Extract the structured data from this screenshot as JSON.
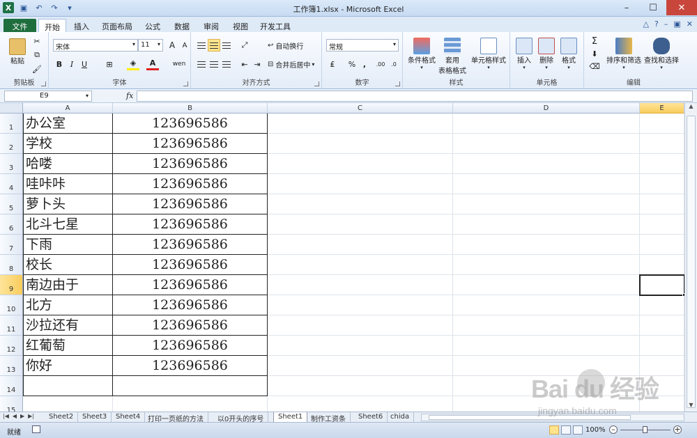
{
  "window": {
    "title": "工作簿1.xlsx - Microsoft Excel",
    "controls": {
      "minimize": "–",
      "maximize": "☐",
      "close": "✕"
    }
  },
  "qat": {
    "logo": "X",
    "save": "💾",
    "undo": "↶",
    "redo": "↷",
    "customize": "▾"
  },
  "tabs": [
    "文件",
    "开始",
    "插入",
    "页面布局",
    "公式",
    "数据",
    "审阅",
    "视图",
    "开发工具"
  ],
  "active_tab": "开始",
  "ribbon": {
    "clipboard": {
      "label": "剪贴板",
      "paste": "粘贴"
    },
    "font": {
      "label": "字体",
      "name": "宋体",
      "size": "11",
      "grow": "A",
      "shrink": "A",
      "bold": "B",
      "italic": "I",
      "underline": "U",
      "fontcolor": "A",
      "phonetic": "wen"
    },
    "alignment": {
      "label": "对齐方式",
      "wrap": "自动换行",
      "merge": "合并后居中"
    },
    "number": {
      "label": "数字",
      "format": "常规",
      "percent": "%",
      "comma": ",",
      "dec_inc": ".00",
      "dec_dec": ".0"
    },
    "styles": {
      "label": "样式",
      "conditional": "条件格式",
      "table_line1": "套用",
      "table_line2": "表格格式",
      "cell_styles": "单元格样式"
    },
    "cells": {
      "label": "单元格",
      "insert": "插入",
      "delete": "删除",
      "format": "格式"
    },
    "editing": {
      "label": "编辑",
      "sum": "Σ",
      "sort": "排序和筛选",
      "find": "查找和选择"
    }
  },
  "formula_bar": {
    "name_box": "E9",
    "fx": "fx",
    "content": ""
  },
  "columns": [
    "A",
    "B",
    "C",
    "D",
    "E"
  ],
  "active_column": "E",
  "rows": [
    {
      "num": "1",
      "a": "办公室",
      "b": "123696586"
    },
    {
      "num": "2",
      "a": "学校",
      "b": "123696586"
    },
    {
      "num": "3",
      "a": "哈喽",
      "b": "123696586"
    },
    {
      "num": "4",
      "a": "哇咔咔",
      "b": "123696586"
    },
    {
      "num": "5",
      "a": "萝卜头",
      "b": "123696586"
    },
    {
      "num": "6",
      "a": "北斗七星",
      "b": "123696586"
    },
    {
      "num": "7",
      "a": "下雨",
      "b": "123696586"
    },
    {
      "num": "8",
      "a": "校长",
      "b": "123696586"
    },
    {
      "num": "9",
      "a": "南边由于",
      "b": "123696586"
    },
    {
      "num": "10",
      "a": "北方",
      "b": "123696586"
    },
    {
      "num": "11",
      "a": "沙拉还有",
      "b": "123696586"
    },
    {
      "num": "12",
      "a": "红葡萄",
      "b": "123696586"
    },
    {
      "num": "13",
      "a": "你好",
      "b": "123696586"
    },
    {
      "num": "14",
      "a": "",
      "b": ""
    },
    {
      "num": "15",
      "a": "",
      "b": ""
    }
  ],
  "active_row": "9",
  "sheets": [
    "Sheet2",
    "Sheet3",
    "Sheet4",
    "打印一页纸的方法",
    "以0开头的序号",
    "Sheet1",
    "制作工资条",
    "Sheet6",
    "chida"
  ],
  "active_sheet": "Sheet1",
  "status": {
    "ready": "就绪",
    "zoom": "100%"
  },
  "watermark": {
    "main": "Bai  du 经验",
    "sub": "jingyan.baidu.com"
  }
}
